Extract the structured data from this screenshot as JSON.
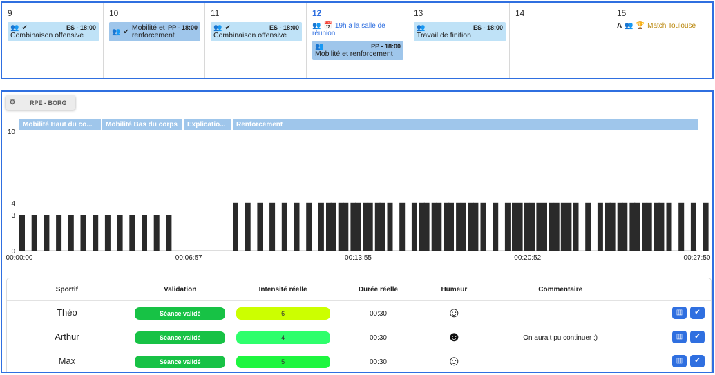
{
  "calendar": {
    "days": [
      {
        "num": "9",
        "events": [
          {
            "code": "ES - 18:00",
            "title": "Combinaison offensive",
            "style": "light"
          }
        ]
      },
      {
        "num": "10",
        "events": [
          {
            "code": "PP - 18:00",
            "title": "Mobilité et renforcement",
            "style": "dark"
          }
        ]
      },
      {
        "num": "11",
        "events": [
          {
            "code": "ES - 18:00",
            "title": "Combinaison offensive",
            "style": "light"
          }
        ]
      },
      {
        "num": "12",
        "reunion": "19h à la salle de réunion",
        "events": [
          {
            "code": "PP - 18:00",
            "title": "Mobilité et renforcement",
            "style": "dark"
          }
        ]
      },
      {
        "num": "13",
        "events": [
          {
            "code": "ES - 18:00",
            "title": "Travail de finition",
            "style": "light"
          }
        ]
      },
      {
        "num": "14",
        "events": []
      },
      {
        "num": "15",
        "match": {
          "prefix": "A",
          "title": "Match Toulouse"
        }
      }
    ]
  },
  "panel": {
    "tab_label": "RPE - BORG",
    "phases": [
      "Mobilité Haut du co...",
      "Mobilité Bas du corps",
      "Explicatio...",
      "Renforcement"
    ]
  },
  "chart_data": {
    "type": "bar",
    "y_ticks": [
      "0",
      "3",
      "4",
      "10"
    ],
    "ylim": [
      0,
      10
    ],
    "x_ticks": [
      "00:00:00",
      "00:06:57",
      "00:13:55",
      "00:20:52",
      "00:27:50"
    ],
    "series": [
      {
        "values": [
          3,
          3,
          3,
          3,
          3,
          3,
          3,
          3,
          3,
          3,
          3,
          3,
          3,
          3,
          3,
          3,
          3,
          3,
          3,
          3,
          3,
          3,
          3,
          3,
          3,
          3,
          4,
          4,
          4,
          4,
          4,
          4,
          4,
          4,
          4,
          4,
          4,
          4,
          4,
          4,
          4,
          4,
          4,
          4,
          4,
          4,
          4,
          4,
          4,
          4,
          4,
          4,
          4,
          4,
          4,
          4,
          4,
          4,
          4,
          4,
          4,
          4,
          4,
          4,
          4,
          4,
          4,
          4,
          4,
          4,
          4,
          4,
          4,
          4,
          4,
          4,
          4,
          4,
          4,
          4,
          4,
          4,
          4,
          4,
          4,
          4,
          4,
          4,
          4,
          4,
          4,
          4,
          4,
          4,
          4,
          4
        ]
      }
    ],
    "colors": {
      "bar": "#2a2a2a",
      "axis": "#bbbbbb"
    }
  },
  "table": {
    "headers": [
      "Sportif",
      "Validation",
      "Intensité réelle",
      "Durée réelle",
      "Humeur",
      "Commentaire"
    ],
    "rows": [
      {
        "name": "Théo",
        "validation": "Séance validé",
        "intensity": "6",
        "intensity_color": "#ccff00",
        "duration": "00:30",
        "mood": "☺",
        "comment": ""
      },
      {
        "name": "Arthur",
        "validation": "Séance validé",
        "intensity": "4",
        "intensity_color": "#2eff6c",
        "duration": "00:30",
        "mood": "☻",
        "comment": "On aurait pu continuer ;)"
      },
      {
        "name": "Max",
        "validation": "Séance validé",
        "intensity": "5",
        "intensity_color": "#1df63f",
        "duration": "00:30",
        "mood": "☺",
        "comment": ""
      }
    ]
  }
}
